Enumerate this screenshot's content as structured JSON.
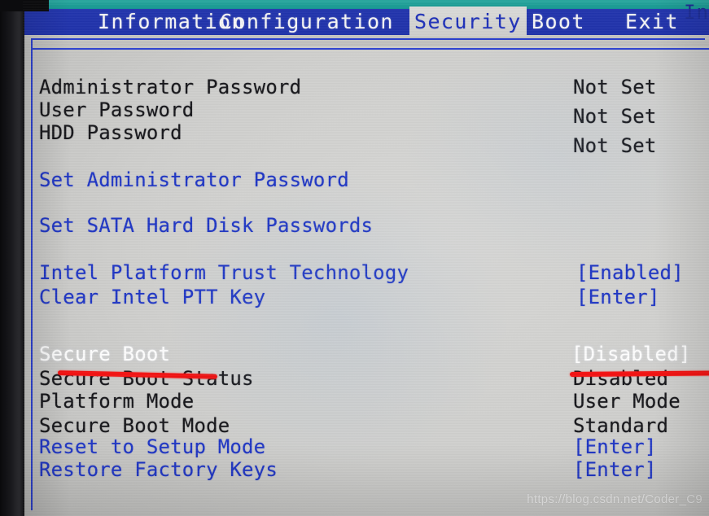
{
  "menu": {
    "tabs": [
      {
        "label": "Information",
        "active": false
      },
      {
        "label": "Configuration",
        "active": false
      },
      {
        "label": "Security",
        "active": true
      },
      {
        "label": "Boot",
        "active": false
      },
      {
        "label": "Exit",
        "active": false
      }
    ],
    "corner_echo": "In"
  },
  "security": {
    "rows": [
      {
        "label": "Administrator Password",
        "value": "Not Set",
        "label_color": "black",
        "value_color": "black"
      },
      {
        "label": "User Password",
        "value": "Not Set",
        "label_color": "black",
        "value_color": "black"
      },
      {
        "label": "HDD Password",
        "value": "Not Set",
        "label_color": "black",
        "value_color": "black"
      },
      {
        "label": "Set Administrator Password",
        "value": "",
        "label_color": "blue",
        "value_color": "blue"
      },
      {
        "label": "Set SATA Hard Disk Passwords",
        "value": "",
        "label_color": "blue",
        "value_color": "blue"
      },
      {
        "label": "Intel Platform Trust Technology",
        "value": "[Enabled]",
        "label_color": "blue",
        "value_color": "blue"
      },
      {
        "label": "Clear Intel PTT Key",
        "value": "[Enter]",
        "label_color": "blue",
        "value_color": "blue"
      },
      {
        "label": "Secure Boot",
        "value": "[Disabled]",
        "label_color": "white",
        "value_color": "white"
      },
      {
        "label": "Secure Boot Status",
        "value": "Disabled",
        "label_color": "black",
        "value_color": "black"
      },
      {
        "label": "Platform Mode",
        "value": "User Mode",
        "label_color": "black",
        "value_color": "black"
      },
      {
        "label": "Secure Boot Mode",
        "value": "Standard",
        "label_color": "black",
        "value_color": "black"
      },
      {
        "label": "Reset to Setup Mode",
        "value": "[Enter]",
        "label_color": "blue",
        "value_color": "blue"
      },
      {
        "label": "Restore Factory Keys",
        "value": "[Enter]",
        "label_color": "blue",
        "value_color": "blue"
      }
    ]
  },
  "annotations": {
    "underline_color": "#f41111",
    "underline_targets": [
      "Secure Boot",
      "[Disabled]"
    ]
  },
  "watermark": {
    "text": "https://blog.csdn.net/Coder_C9"
  },
  "colors": {
    "menu_bar_blue": "#2438b8",
    "teal_strip": "#1aa49c",
    "panel_gray": "#cfcfcd",
    "text_blue": "#1f36c4",
    "text_black": "#16161a",
    "highlight_white": "#fdfdfd"
  }
}
